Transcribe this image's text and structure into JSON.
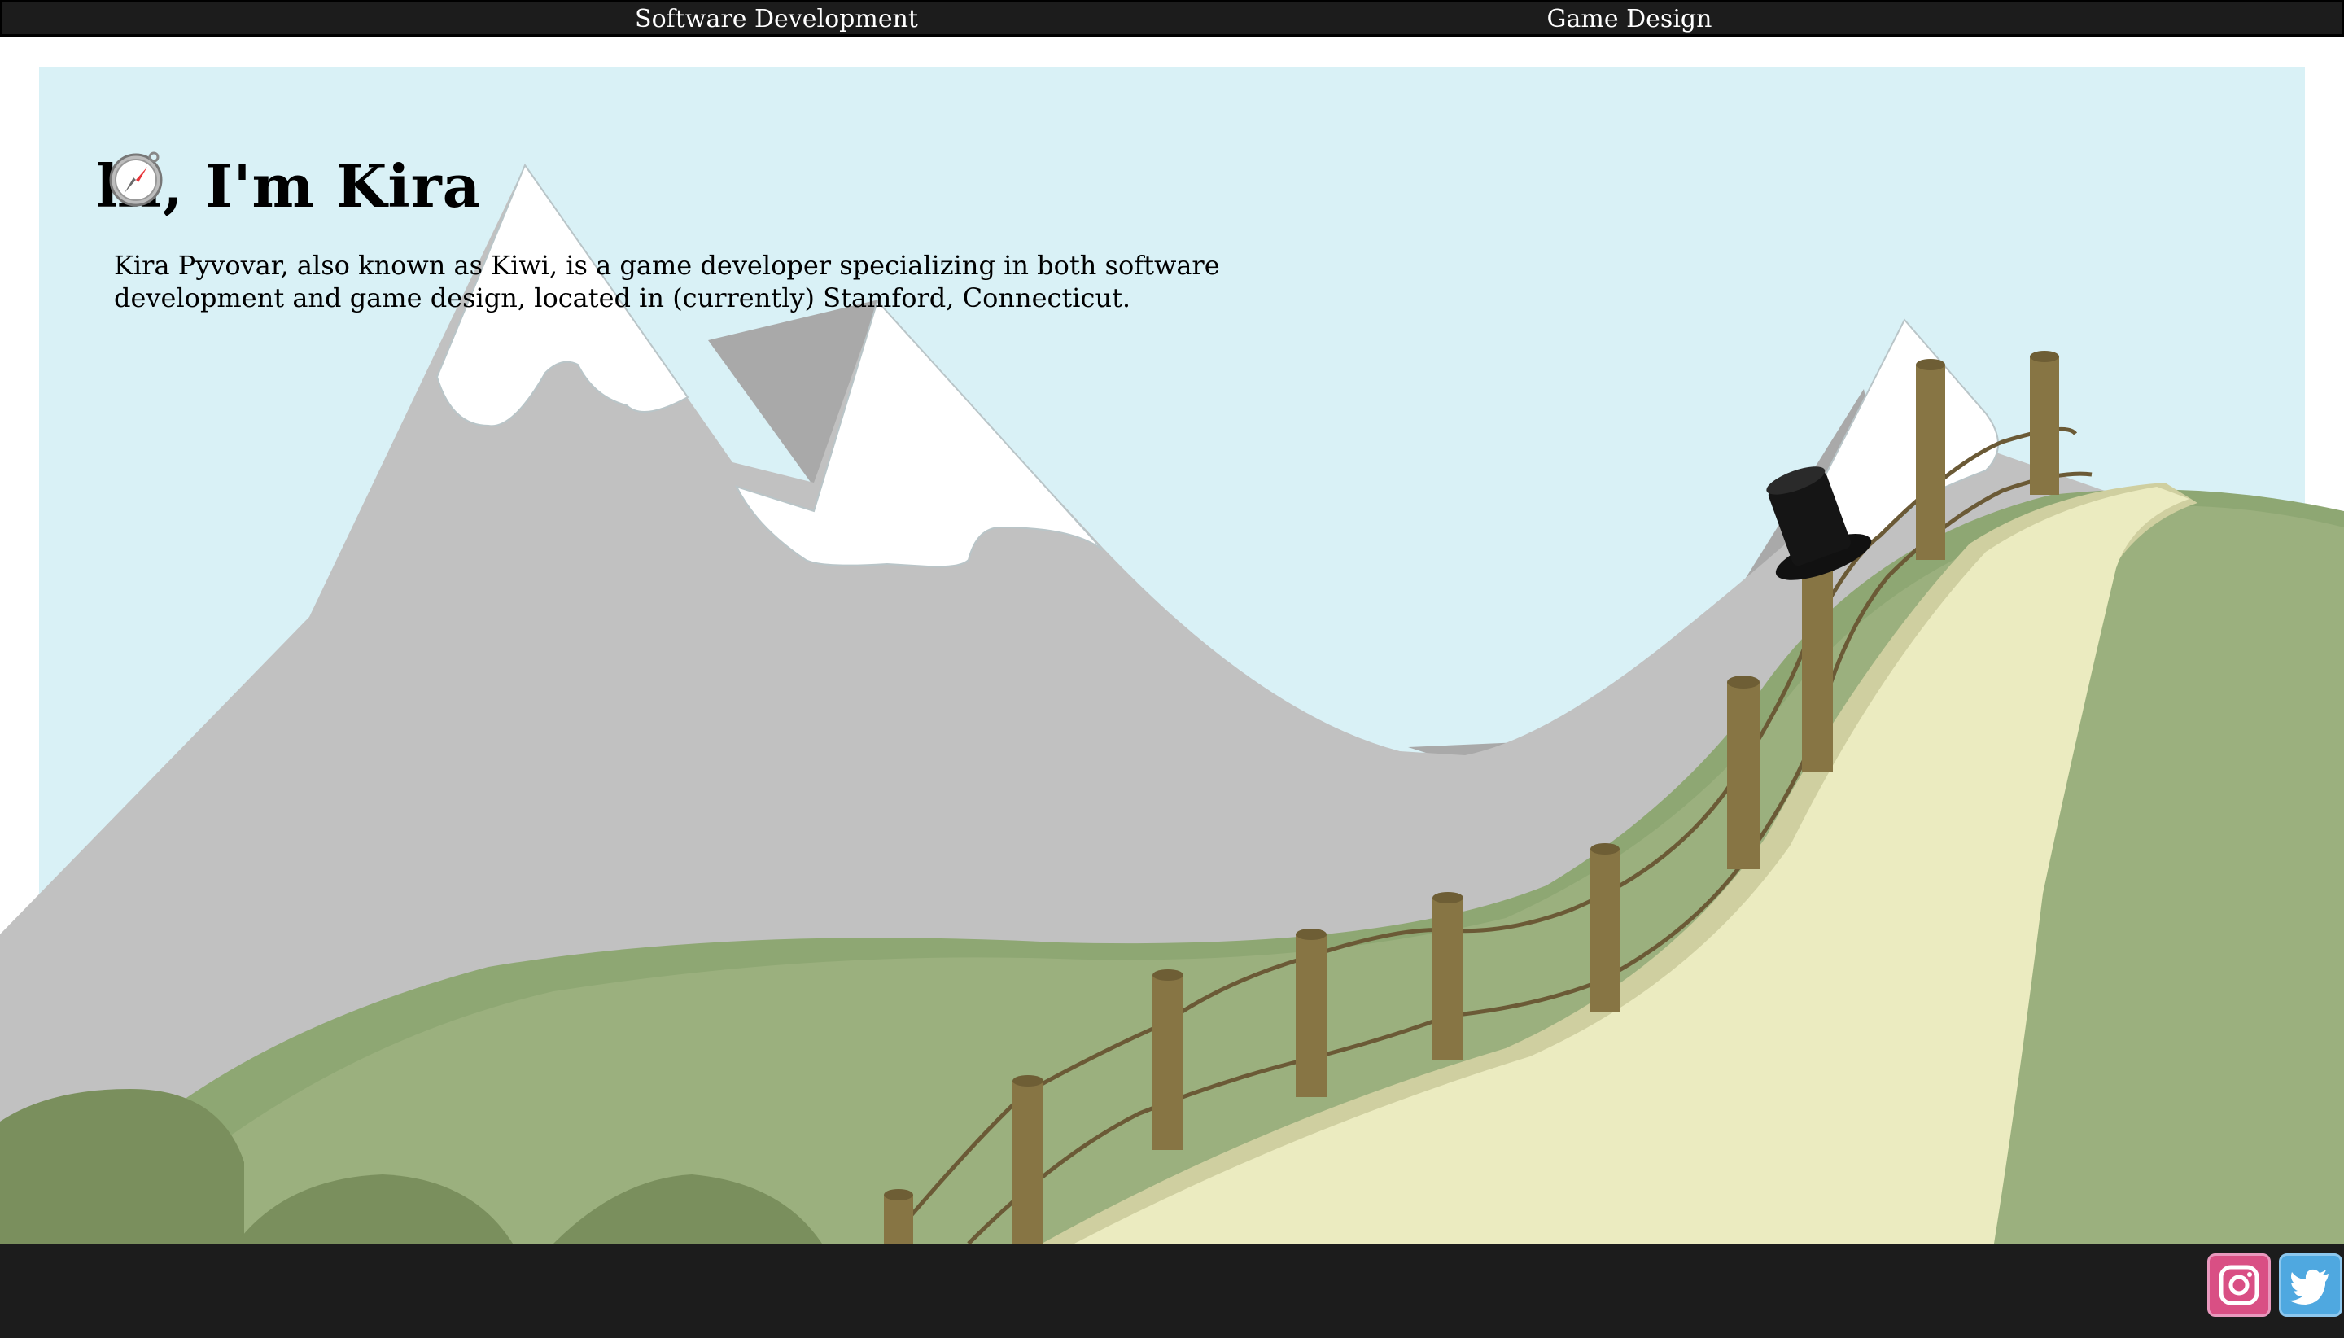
{
  "nav": {
    "software_label": "Software Development",
    "game_label": "Game Design"
  },
  "hero": {
    "title": "hi, I'm Kira",
    "title_icon": "compass-icon",
    "intro": "Kira Pyvovar, also known as Kiwi, is a game developer specializing in both software development and game design, located in (currently) Stamford, Connecticut."
  },
  "footer": {
    "social": [
      {
        "name": "instagram-icon",
        "color": "#d94f84"
      },
      {
        "name": "twitter-icon",
        "color": "#4fa8e0"
      }
    ]
  },
  "colors": {
    "nav_bg": "#1c1c1c",
    "sky": "#d9f1f6",
    "mountain": "#c1c1c1",
    "snow": "#ffffff",
    "hill": "#9bb07e",
    "path": "#ebebc0",
    "post": "#877544"
  }
}
